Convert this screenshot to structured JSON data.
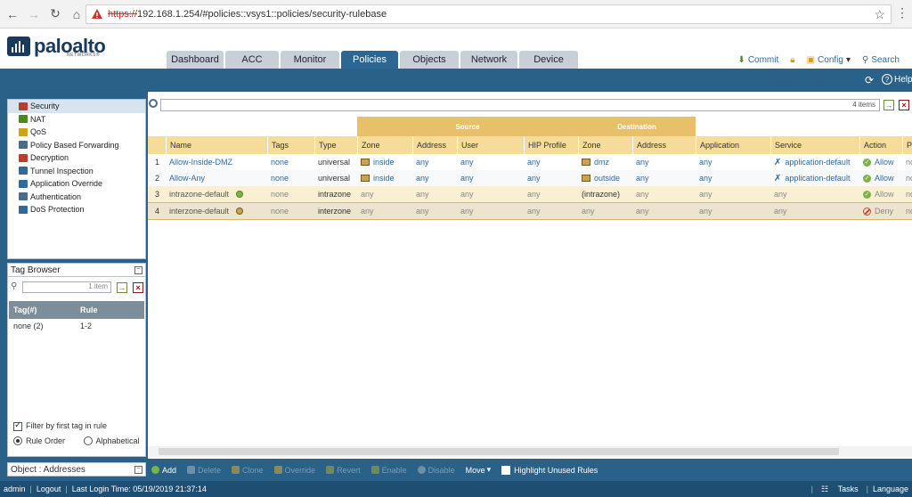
{
  "browser": {
    "url_scheme": "https://",
    "url_rest": "192.168.1.254/#policies::vsys1::policies/security-rulebase"
  },
  "brand": {
    "name": "paloalto",
    "sub": "NETWORKS®"
  },
  "tabs": [
    {
      "label": "Dashboard",
      "active": false
    },
    {
      "label": "ACC",
      "active": false
    },
    {
      "label": "Monitor",
      "active": false
    },
    {
      "label": "Policies",
      "active": true
    },
    {
      "label": "Objects",
      "active": false
    },
    {
      "label": "Network",
      "active": false
    },
    {
      "label": "Device",
      "active": false
    }
  ],
  "header_actions": {
    "commit": "Commit",
    "config": "Config",
    "search": "Search"
  },
  "help_label": "Help",
  "sidebar": {
    "items": [
      {
        "label": "Security",
        "color": "#c0392b"
      },
      {
        "label": "NAT",
        "color": "#4a8a1a"
      },
      {
        "label": "QoS",
        "color": "#d4a017"
      },
      {
        "label": "Policy Based Forwarding",
        "color": "#4a6b8a"
      },
      {
        "label": "Decryption",
        "color": "#c0392b"
      },
      {
        "label": "Tunnel Inspection",
        "color": "#2d6aa0"
      },
      {
        "label": "Application Override",
        "color": "#2d6aa0"
      },
      {
        "label": "Authentication",
        "color": "#4a6b8a"
      },
      {
        "label": "DoS Protection",
        "color": "#2d6aa0"
      }
    ]
  },
  "tag_browser": {
    "title": "Tag Browser",
    "search_count": "1 item",
    "columns": [
      "Tag(#)",
      "Rule"
    ],
    "rows": [
      {
        "tag": "none (2)",
        "rule": "1-2"
      }
    ],
    "filter_first_tag": "Filter by first tag in rule",
    "rule_order": "Rule Order",
    "alphabetical": "Alphabetical"
  },
  "object_panel": "Object : Addresses",
  "filter": {
    "count": "4 items"
  },
  "grid": {
    "group_source": "Source",
    "group_destination": "Destination",
    "columns": {
      "name": "Name",
      "tags": "Tags",
      "type": "Type",
      "src_zone": "Zone",
      "src_address": "Address",
      "user": "User",
      "hip": "HIP Profile",
      "dst_zone": "Zone",
      "dst_address": "Address",
      "application": "Application",
      "service": "Service",
      "action": "Action",
      "profile": "P"
    },
    "rows": [
      {
        "num": "1",
        "name": "Allow-Inside-DMZ",
        "tags": "none",
        "type": "universal",
        "src_zone": "inside",
        "src_address": "any",
        "user": "any",
        "hip": "any",
        "dst_zone": "dmz",
        "dst_address": "any",
        "application": "any",
        "service": "application-default",
        "action": "Allow",
        "profile": "no"
      },
      {
        "num": "2",
        "name": "Allow-Any",
        "tags": "none",
        "type": "universal",
        "src_zone": "inside",
        "src_address": "any",
        "user": "any",
        "hip": "any",
        "dst_zone": "outside",
        "dst_address": "any",
        "application": "any",
        "service": "application-default",
        "action": "Allow",
        "profile": "no"
      },
      {
        "num": "3",
        "name": "intrazone-default",
        "tags": "none",
        "type": "intrazone",
        "src_zone": "any",
        "src_address": "any",
        "user": "any",
        "hip": "any",
        "dst_zone": "(intrazone)",
        "dst_address": "any",
        "application": "any",
        "service": "any",
        "action": "Allow",
        "profile": "no"
      },
      {
        "num": "4",
        "name": "interzone-default",
        "tags": "none",
        "type": "interzone",
        "src_zone": "any",
        "src_address": "any",
        "user": "any",
        "hip": "any",
        "dst_zone": "any",
        "dst_address": "any",
        "application": "any",
        "service": "any",
        "action": "Deny",
        "profile": "no"
      }
    ]
  },
  "actions": {
    "add": "Add",
    "delete": "Delete",
    "clone": "Clone",
    "override": "Override",
    "revert": "Revert",
    "enable": "Enable",
    "disable": "Disable",
    "move": "Move",
    "highlight": "Highlight Unused Rules"
  },
  "status": {
    "user": "admin",
    "logout": "Logout",
    "last_login": "Last Login Time: 05/19/2019 21:37:14",
    "tasks": "Tasks",
    "language": "Language"
  }
}
